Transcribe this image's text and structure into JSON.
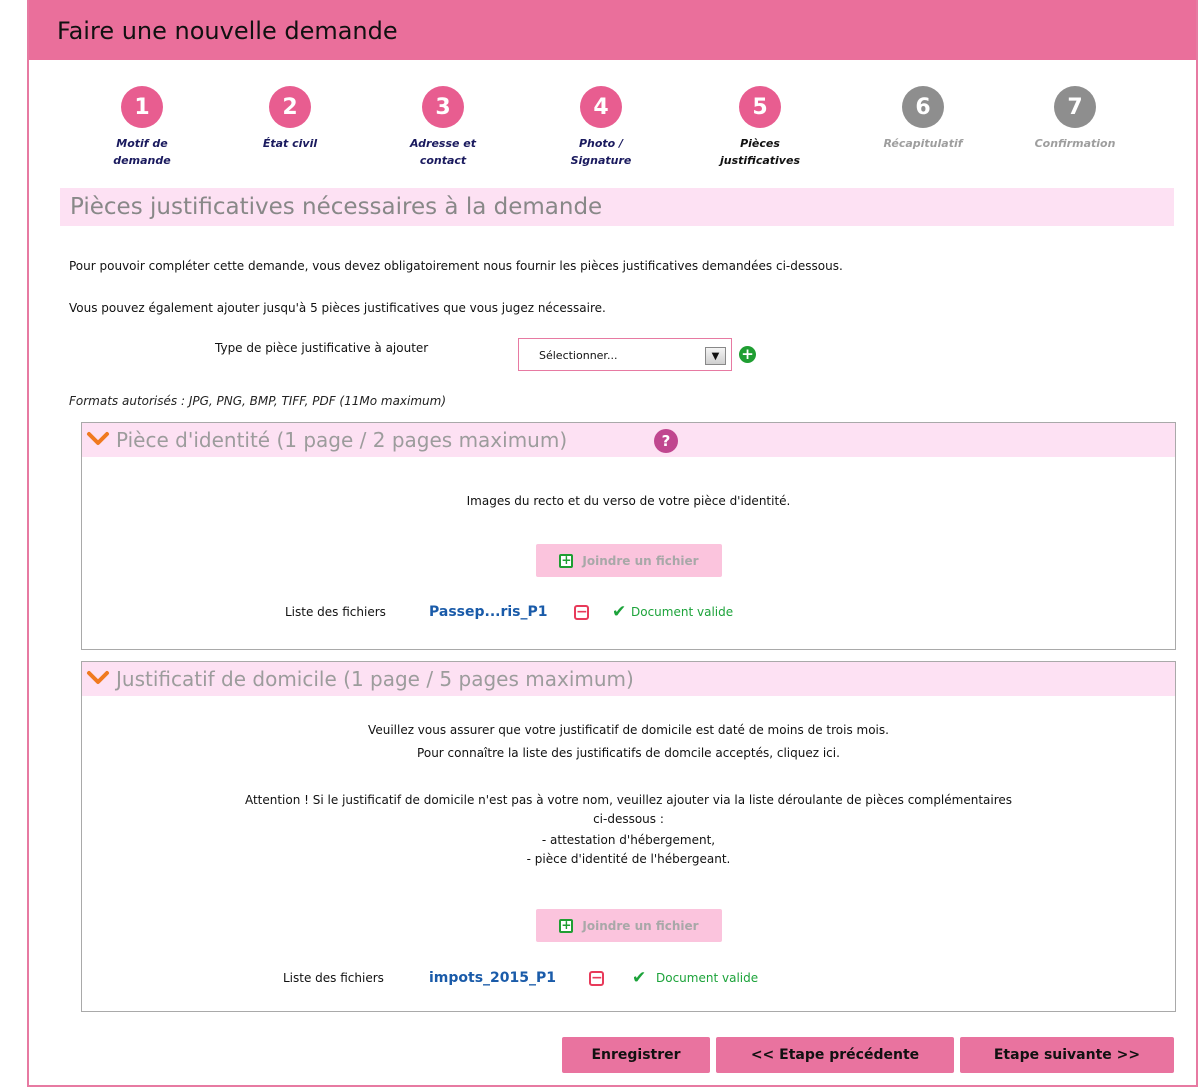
{
  "header": {
    "title": "Faire une nouvelle demande"
  },
  "steps": [
    {
      "num": "1",
      "label": "Motif de demande",
      "state": "active"
    },
    {
      "num": "2",
      "label": "État civil",
      "state": "active"
    },
    {
      "num": "3",
      "label": "Adresse et contact",
      "state": "active"
    },
    {
      "num": "4",
      "label": "Photo / Signature",
      "state": "active"
    },
    {
      "num": "5",
      "label": "Pièces justificatives",
      "state": "current"
    },
    {
      "num": "6",
      "label": "Récapitulatif",
      "state": "inactive"
    },
    {
      "num": "7",
      "label": "Confirmation",
      "state": "inactive"
    }
  ],
  "section": {
    "title": "Pièces justificatives nécessaires à la demande",
    "intro1": "Pour pouvoir compléter cette demande, vous devez obligatoirement nous fournir les pièces justificatives demandées ci-dessous.",
    "intro2": "Vous pouvez également ajouter jusqu'à 5 pièces justificatives que vous jugez nécessaire.",
    "type_label": "Type de pièce justificative à ajouter",
    "select_value": "Sélectionner...",
    "formats": "Formats autorisés : JPG, PNG, BMP, TIFF, PDF (11Mo maximum)"
  },
  "panels": [
    {
      "title": "Pièce d'identité (1 page / 2 pages maximum)",
      "help": "?",
      "description": "Images du recto et du verso de votre pièce d'identité.",
      "join_label": "Joindre un fichier",
      "files_label": "Liste des fichiers",
      "file_name": "Passep...ris_P1",
      "status": "Document valide"
    },
    {
      "title": "Justificatif de domicile (1 page / 5 pages maximum)",
      "lines": [
        "Veuillez vous assurer que votre justificatif de domicile est daté de moins de trois mois.",
        "Pour connaître la liste des justificatifs de domcile acceptés, cliquez ici.",
        "Attention ! Si le justificatif de domicile n'est pas à votre nom, veuillez ajouter via la liste déroulante de pièces complémentaires",
        "ci-dessous :",
        "- attestation d'hébergement,",
        "- pièce d'identité de l'hébergeant."
      ],
      "join_label": "Joindre un fichier",
      "files_label": "Liste des fichiers",
      "file_name": "impots_2015_P1",
      "status": "Document valide"
    }
  ],
  "footer": {
    "save": "Enregistrer",
    "prev": "<< Etape précédente",
    "next": "Etape suivante >>"
  },
  "colors": {
    "accent": "#ea6f9b",
    "panel_header": "#fde1f3",
    "step_inactive": "#8e8e8e",
    "valid": "#1ca33a"
  }
}
